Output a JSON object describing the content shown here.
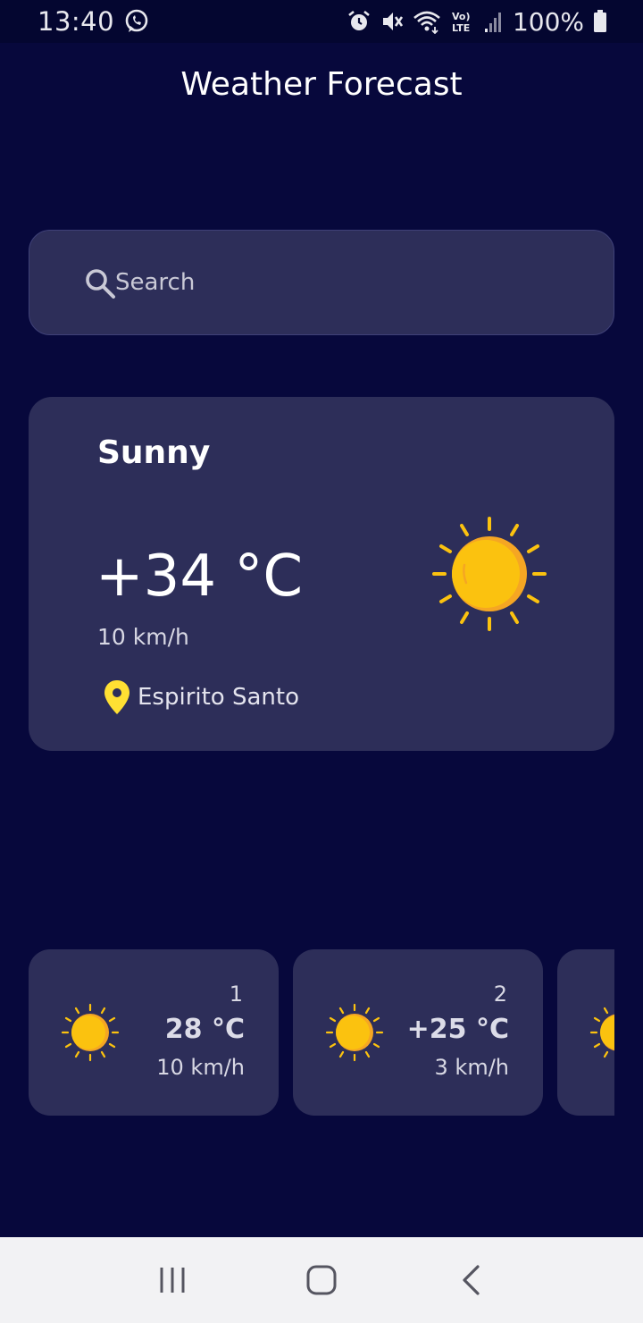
{
  "status_bar": {
    "time": "13:40",
    "battery": "100%",
    "icons": [
      "whatsapp-icon",
      "alarm-icon",
      "mute-icon",
      "wifi-icon",
      "volte-icon",
      "signal-icon",
      "battery-icon"
    ]
  },
  "app": {
    "title": "Weather Forecast"
  },
  "search": {
    "placeholder": "Search",
    "value": ""
  },
  "current": {
    "condition": "Sunny",
    "temperature": "+34 °C",
    "wind": "10 km/h",
    "location": "Espirito Santo",
    "icon": "sun-icon"
  },
  "forecast": [
    {
      "day": "1",
      "temperature": "28 °C",
      "wind": "10 km/h",
      "icon": "sun-icon"
    },
    {
      "day": "2",
      "temperature": "+25 °C",
      "wind": "3 km/h",
      "icon": "sun-icon"
    },
    {
      "day": "",
      "temperature": "",
      "wind": "",
      "icon": "sun-icon"
    }
  ],
  "colors": {
    "background": "#07083c",
    "card": "#2d2e59",
    "sun": "#fbc20f",
    "sun_shade": "#f5a623",
    "pin": "#ffe033"
  },
  "nav": [
    "recent-apps-icon",
    "home-icon",
    "back-icon"
  ]
}
